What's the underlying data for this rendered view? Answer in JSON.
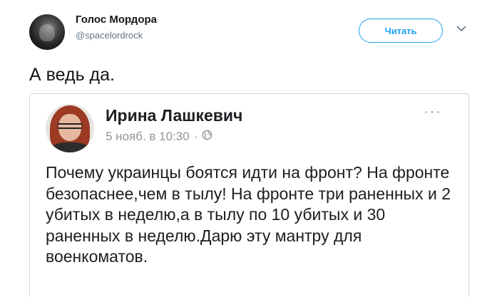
{
  "tweet": {
    "display_name": "Голос Мордора",
    "handle": "@spacelordrock",
    "follow_label": "Читать",
    "caret_icon": "chevron-down-icon",
    "text": "А ведь да."
  },
  "quoted_post": {
    "author_name": "Ирина Лашкевич",
    "timestamp": "5 нояб. в 10:30",
    "separator": "·",
    "privacy_icon": "globe-icon",
    "more_label": "···",
    "text": "Почему украинцы боятся идти на фронт? На фронте безопаснее,чем в тылу! На фронте три раненных и 2 убитых в неделю,а в тылу по 10 убитых и 30 раненных в неделю.Дарю эту мантру для военкоматов."
  },
  "colors": {
    "accent": "#1da1f2",
    "muted": "#657786",
    "border": "#ccd6dd",
    "fb_muted": "#90949c"
  }
}
